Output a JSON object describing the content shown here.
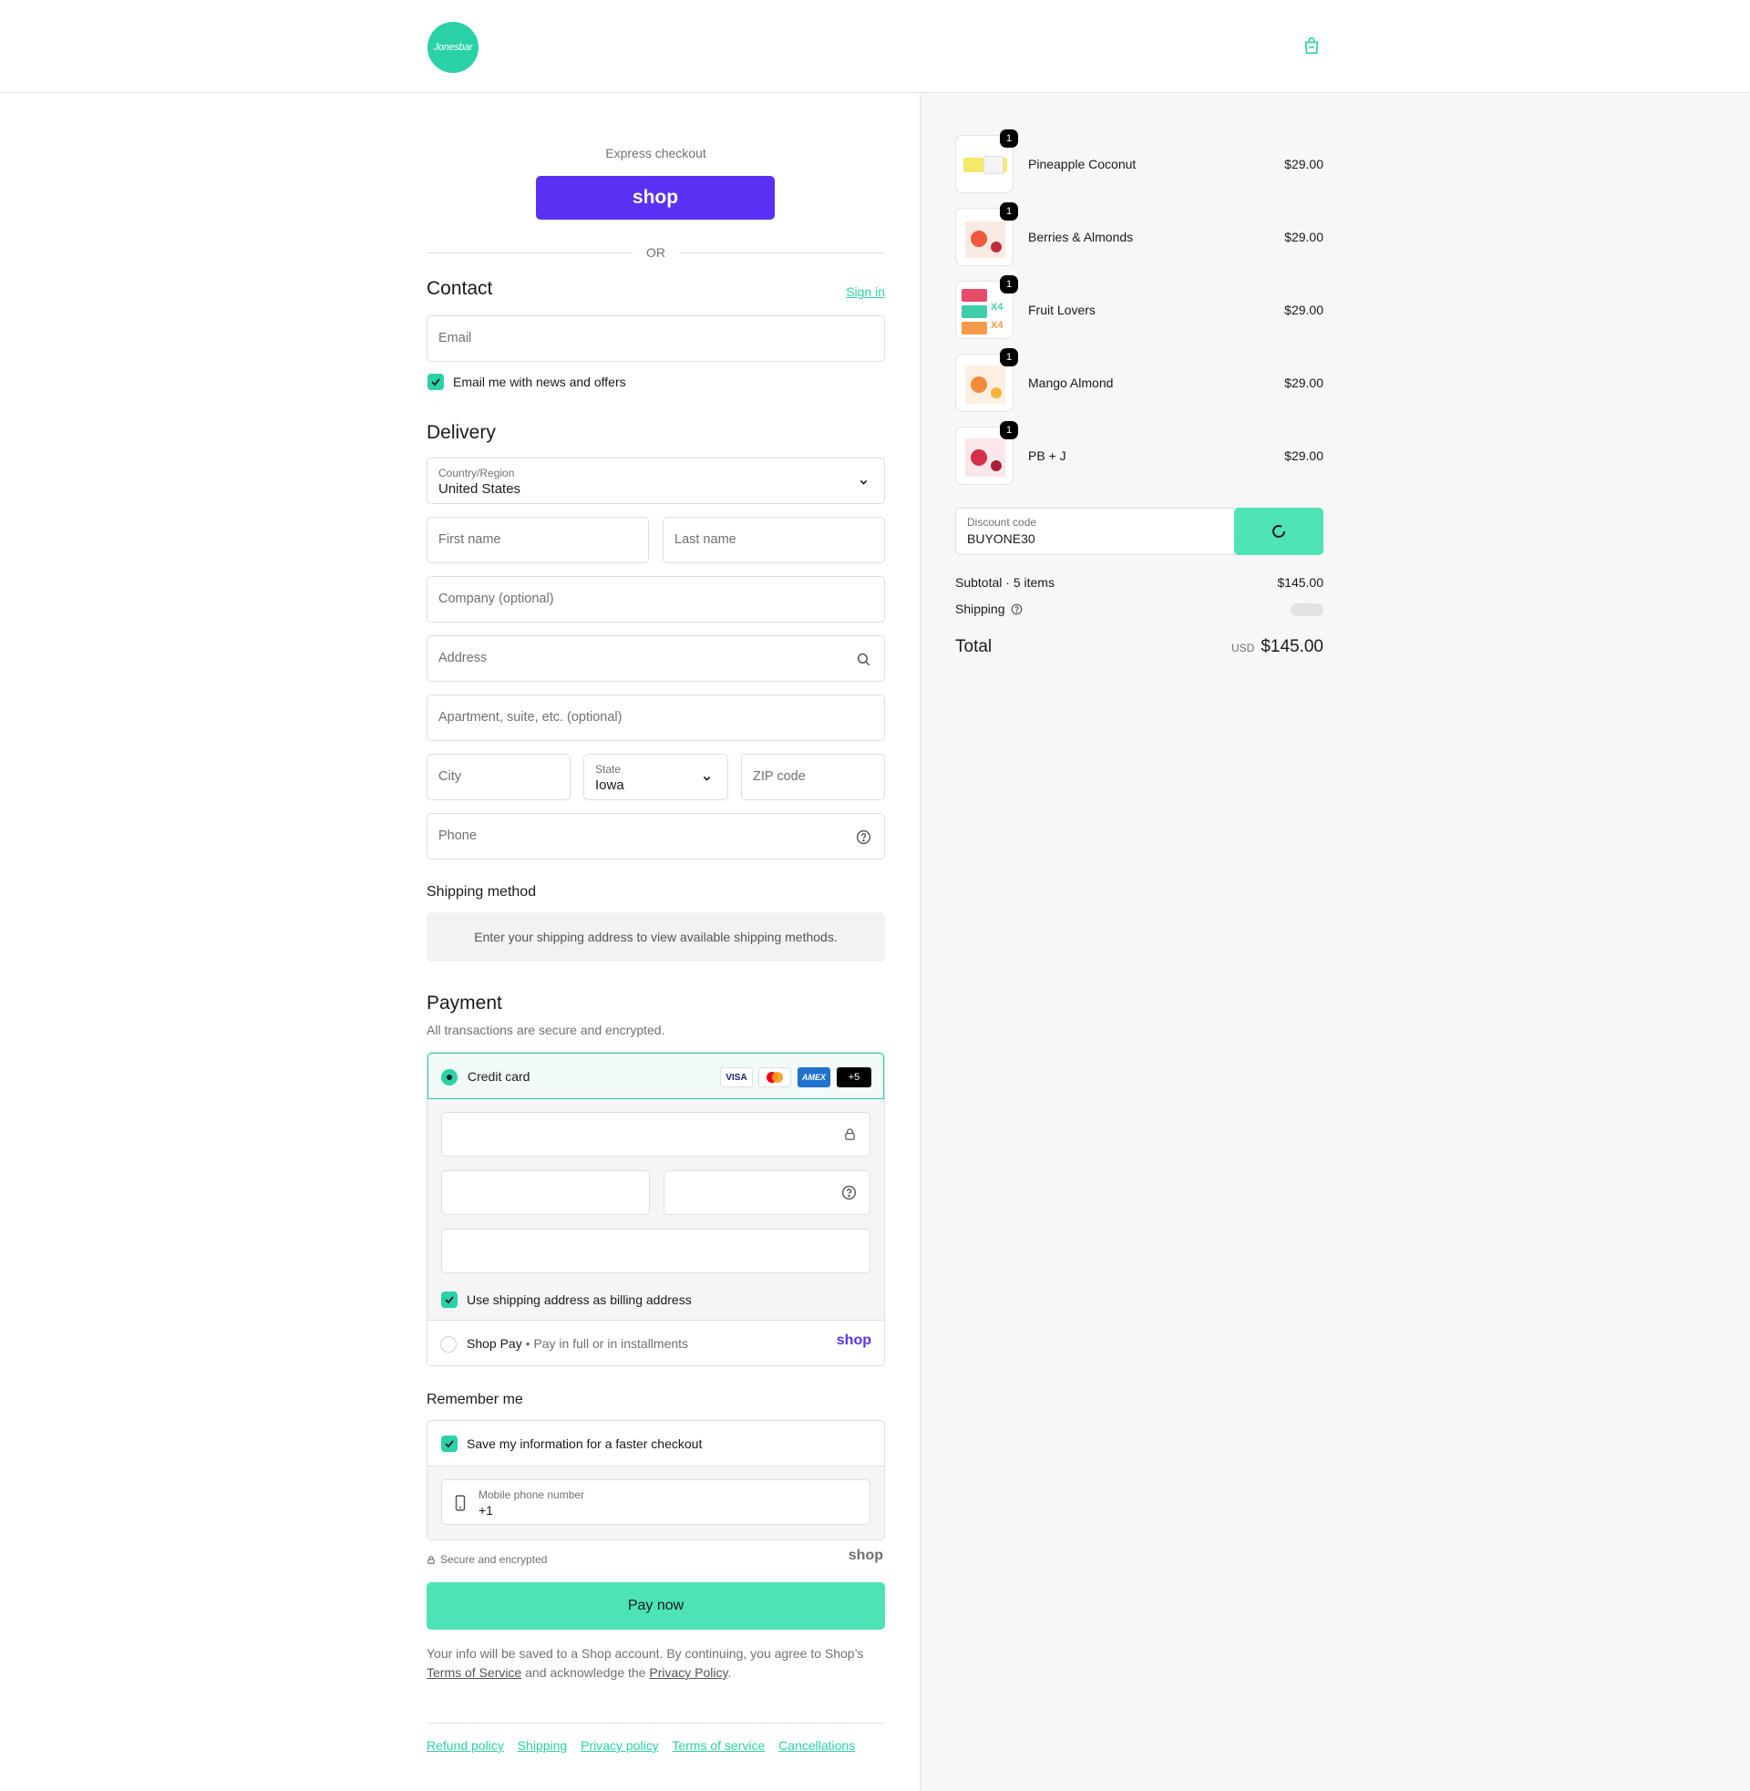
{
  "header": {
    "logo_text": "Jonesbar",
    "cart_icon": "shopping-bag-icon"
  },
  "express": {
    "title": "Express checkout",
    "shop_button": "shop",
    "or": "OR"
  },
  "contact": {
    "title": "Contact",
    "sign_in": "Sign in",
    "email_placeholder": "Email",
    "news_label": "Email me with news and offers"
  },
  "delivery": {
    "title": "Delivery",
    "country_label": "Country/Region",
    "country_value": "United States",
    "first_name_placeholder": "First name",
    "last_name_placeholder": "Last name",
    "company_placeholder": "Company (optional)",
    "address_placeholder": "Address",
    "apartment_placeholder": "Apartment, suite, etc. (optional)",
    "city_placeholder": "City",
    "state_label": "State",
    "state_value": "Iowa",
    "zip_placeholder": "ZIP code",
    "phone_placeholder": "Phone"
  },
  "shipping_method": {
    "title": "Shipping method",
    "message": "Enter your shipping address to view available shipping methods."
  },
  "payment": {
    "title": "Payment",
    "subtitle": "All transactions are secure and encrypted.",
    "credit_card_label": "Credit card",
    "card_logos": [
      "VISA",
      "Mastercard",
      "AMEX",
      "+5"
    ],
    "billing_label": "Use shipping address as billing address",
    "shop_pay_label": "Shop Pay",
    "shop_pay_sub": "Pay in full or in installments",
    "shop_pay_logo": "shop"
  },
  "remember": {
    "title": "Remember me",
    "save_label": "Save my information for a faster checkout",
    "phone_label": "Mobile phone number",
    "phone_value": "+1"
  },
  "secure": {
    "label": "Secure and encrypted",
    "shop_logo": "shop"
  },
  "pay_now": "Pay now",
  "legal": {
    "line1": "Your info will be saved to a Shop account. By continuing, you agree to Shop’s",
    "terms_link": "Terms of Service",
    "middle": "and acknowledge the",
    "privacy_link": "Privacy Policy",
    "end": "."
  },
  "footer_links": [
    "Refund policy",
    "Shipping",
    "Privacy policy",
    "Terms of service",
    "Cancellations"
  ],
  "cart": {
    "items": [
      {
        "name": "Pineapple Coconut",
        "price": "$29.00",
        "qty": "1"
      },
      {
        "name": "Berries & Almonds",
        "price": "$29.00",
        "qty": "1"
      },
      {
        "name": "Fruit Lovers",
        "price": "$29.00",
        "qty": "1"
      },
      {
        "name": "Mango Almond",
        "price": "$29.00",
        "qty": "1"
      },
      {
        "name": "PB + J",
        "price": "$29.00",
        "qty": "1"
      }
    ],
    "discount_label": "Discount code",
    "discount_value": "BUYONE30",
    "subtotal_label": "Subtotal · 5 items",
    "subtotal_value": "$145.00",
    "shipping_label": "Shipping",
    "total_label": "Total",
    "currency": "USD",
    "total_value": "$145.00"
  },
  "colors": {
    "accent": "#2ad1a7",
    "button": "#4ee3b7",
    "shop_purple": "#5a31f4"
  }
}
